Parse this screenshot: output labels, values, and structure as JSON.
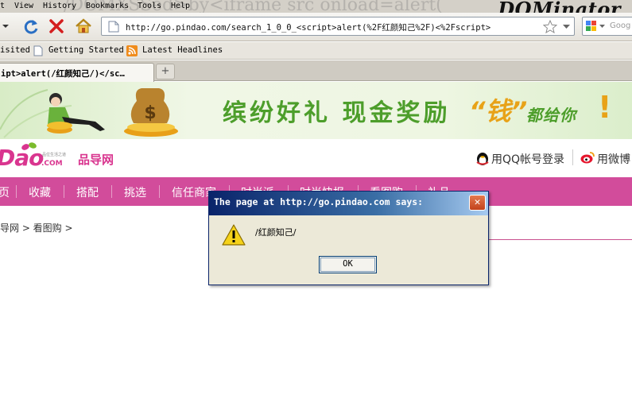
{
  "menu": [
    "t",
    "View",
    "History",
    "Bookmarks",
    "Tools",
    "Help"
  ],
  "watermark": "/DOMXSSed>by<iframe src onload=alert(",
  "extension_title": "DOMinator",
  "toolbar": {
    "url": "http://go.pindao.com/search_1_0_0_<script>alert(%2F红颜知己%2F)<%2Fscript>",
    "search_placeholder": "Goog"
  },
  "bookmarks": [
    "isited",
    "Getting Started",
    "Latest Headlines"
  ],
  "tab": {
    "title": "ipt>alert(/红颜知己/)</sc…",
    "new_tab_symbol": "+"
  },
  "banner": {
    "text": "缤纷好礼 现金奖励",
    "money": "“钱”",
    "suffix": "都给你",
    "exclaim": "!"
  },
  "site": {
    "logo": "Dao",
    "logo_com": ".COM",
    "logo_tagline": "品位生活之道",
    "logo_cn": "品导网",
    "qq_login": "用QQ帐号登录",
    "weibo_login": "用微博",
    "nav": [
      "页",
      "收藏",
      "搭配",
      "挑选",
      "信任商家",
      "时尚派",
      "时尚快报",
      "看图购",
      "礼品"
    ],
    "breadcrumb": "导网 > 看图购 >"
  },
  "dialog": {
    "title": "The page at http://go.pindao.com says:",
    "message": "/红颜知己/",
    "ok": "OK"
  },
  "colors": {
    "brand_pink": "#d24c9b",
    "banner_green": "#4d9e2b",
    "banner_gold": "#e8a218",
    "title_blue": "#0a246a"
  }
}
